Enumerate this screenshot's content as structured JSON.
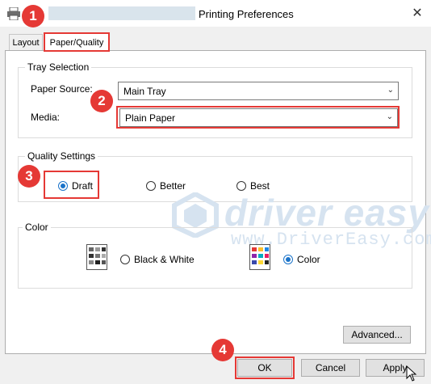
{
  "window": {
    "title": "Printing Preferences"
  },
  "tabs": [
    {
      "label": "Layout"
    },
    {
      "label": "Paper/Quality"
    }
  ],
  "tray_selection": {
    "title": "Tray Selection",
    "paper_source_label": "Paper Source:",
    "paper_source_value": "Main Tray",
    "media_label": "Media:",
    "media_value": "Plain Paper"
  },
  "quality": {
    "title": "Quality Settings",
    "options": [
      {
        "label": "Draft",
        "selected": true
      },
      {
        "label": "Better",
        "selected": false
      },
      {
        "label": "Best",
        "selected": false
      }
    ]
  },
  "color": {
    "title": "Color",
    "options": [
      {
        "label": "Black & White",
        "selected": false
      },
      {
        "label": "Color",
        "selected": true
      }
    ]
  },
  "buttons": {
    "advanced": "Advanced...",
    "ok": "OK",
    "cancel": "Cancel",
    "apply": "Apply"
  },
  "badges": [
    "1",
    "2",
    "3",
    "4"
  ],
  "watermark": {
    "brand": "driver easy",
    "url": "www.DriverEasy.com"
  },
  "icons": {
    "printer": "printer-icon",
    "close": "close-icon",
    "chevron": "chevron-down-icon",
    "bw": "black-white-icon",
    "color": "color-palette-icon",
    "cursor": "mouse-cursor-icon",
    "logo": "driver-easy-logo-icon"
  },
  "colors": {
    "highlight": "#e53935",
    "radio": "#1a73c9"
  }
}
